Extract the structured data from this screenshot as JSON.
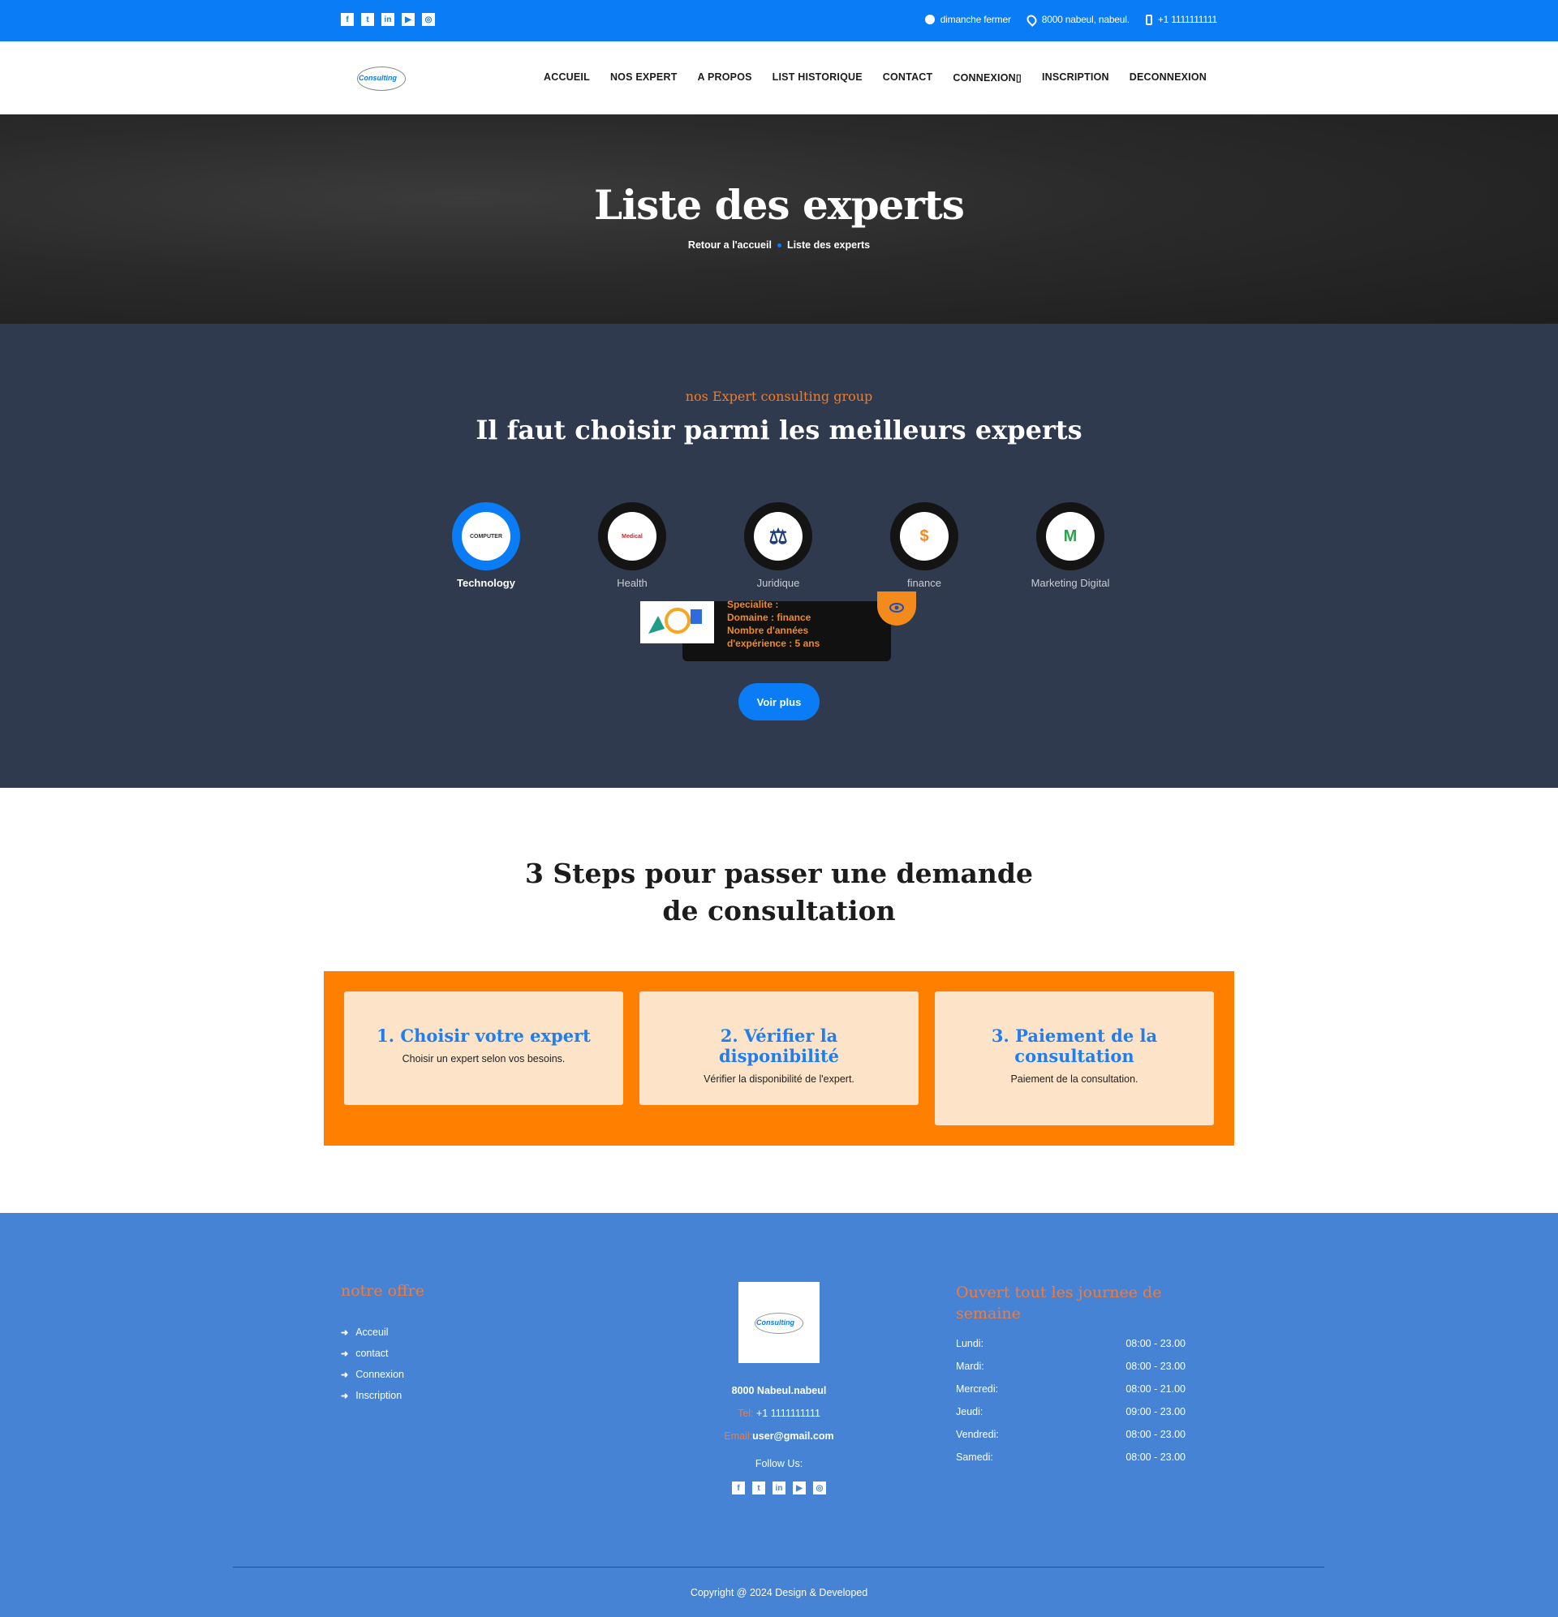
{
  "topbar": {
    "socials": [
      "facebook-icon",
      "twitter-icon",
      "linkedin-icon",
      "youtube-icon",
      "instagram-icon"
    ],
    "hours": "dimanche fermer",
    "address": "8000 nabeul, nabeul.",
    "phone": "+1 1111111111"
  },
  "brand": {
    "logo_text": "Consulting"
  },
  "nav": {
    "items": [
      "ACCUEIL",
      "NOS EXPERT",
      "A PROPOS",
      "LIST HISTORIQUE",
      "CONTACT",
      "CONNEXION▯",
      "INSCRIPTION",
      "DECONNEXION"
    ]
  },
  "hero": {
    "title": "Liste des experts",
    "breadcrumb_home": "Retour a l'accueil",
    "breadcrumb_current": "Liste des experts"
  },
  "experts": {
    "subtitle": "nos Expert consulting group",
    "title": "Il faut choisir parmi les meilleurs experts",
    "categories": [
      {
        "label": "Technology",
        "icon": "computer-icon",
        "icon_text": "COMPUTER",
        "active": true
      },
      {
        "label": "Health",
        "icon": "stethoscope-icon",
        "icon_text": "Medical",
        "active": false
      },
      {
        "label": "Juridique",
        "icon": "scales-icon",
        "icon_text": "",
        "active": false
      },
      {
        "label": "finance",
        "icon": "money-icon",
        "icon_text": "$",
        "active": false
      },
      {
        "label": "Marketing Digital",
        "icon": "marketing-icon",
        "icon_text": "M",
        "active": false
      }
    ],
    "card": {
      "line1": "Specialite :",
      "line2": "Domaine : finance",
      "line3": "Nombre d'années",
      "line4": "d'expérience : 5 ans"
    },
    "more_button": "Voir plus"
  },
  "steps": {
    "title": "3 Steps pour passer une demande de consultation",
    "items": [
      {
        "title": "1. Choisir votre expert",
        "text": "Choisir un expert selon vos besoins."
      },
      {
        "title": "2. Vérifier la disponibilité",
        "text": "Vérifier la disponibilité de l'expert."
      },
      {
        "title": "3. Paiement de la consultation",
        "text": "Paiement de la consultation."
      }
    ]
  },
  "footer": {
    "offer_title": "notre offre",
    "links": [
      "Acceuil",
      "contact",
      "Connexion",
      "Inscription"
    ],
    "logo_text": "Consulting",
    "address": "8000 Nabeul.nabeul",
    "tel_label": "Tel:",
    "tel": "+1 1111111111",
    "email_label": "Email:",
    "email": "user@gmail.com",
    "follow": "Follow Us:",
    "hours_title": "Ouvert tout les journee de semaine",
    "hours": [
      {
        "day": "Lundi:",
        "time": "08:00 - 23.00"
      },
      {
        "day": "Mardi:",
        "time": "08:00 - 23.00"
      },
      {
        "day": "Mercredi:",
        "time": "08:00 - 21.00"
      },
      {
        "day": "Jeudi:",
        "time": "09:00 - 23.00"
      },
      {
        "day": "Vendredi:",
        "time": "08:00 - 23.00"
      },
      {
        "day": "Samedi:",
        "time": "08:00 - 23.00"
      }
    ],
    "copyright": "Copyright @ 2024 Design & Developed"
  },
  "colors": {
    "primary": "#0a7cf5",
    "accent": "#ff7f00",
    "dark_section": "#2f3a4e",
    "footer": "#4683d5"
  }
}
